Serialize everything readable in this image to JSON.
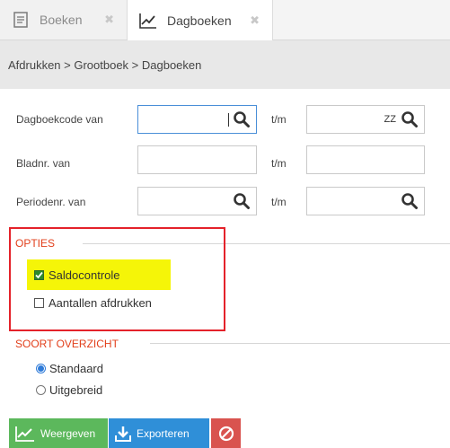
{
  "tabs": [
    {
      "label": "Boeken",
      "icon": "document-icon",
      "active": false
    },
    {
      "label": "Dagboeken",
      "icon": "line-chart-icon",
      "active": true
    }
  ],
  "breadcrumb": "Afdrukken > Grootboek > Dagboeken",
  "filters": {
    "dagboekcode_label": "Dagboekcode van",
    "dagboekcode_from": "",
    "dagboekcode_to": "ZZ",
    "bladnr_label": "Bladnr. van",
    "bladnr_from": "",
    "bladnr_to": "",
    "periodenr_label": "Periodenr. van",
    "periodenr_from": "",
    "periodenr_to": "",
    "tm_label": "t/m"
  },
  "opties": {
    "title": "OPTIES",
    "saldocontrole": {
      "label": "Saldocontrole",
      "checked": true
    },
    "aantallen": {
      "label": "Aantallen afdrukken",
      "checked": false
    }
  },
  "soort": {
    "title": "SOORT OVERZICHT",
    "options": [
      {
        "label": "Standaard",
        "selected": true
      },
      {
        "label": "Uitgebreid",
        "selected": false
      }
    ]
  },
  "buttons": {
    "weergeven": "Weergeven",
    "exporteren": "Exporteren"
  },
  "colors": {
    "section_title": "#e2401c",
    "highlight_box": "#e4222a",
    "highlight_fill": "#f5f508",
    "green_button": "#5cb85c",
    "blue_button": "#2f8fd8",
    "red_button": "#d9534f"
  }
}
